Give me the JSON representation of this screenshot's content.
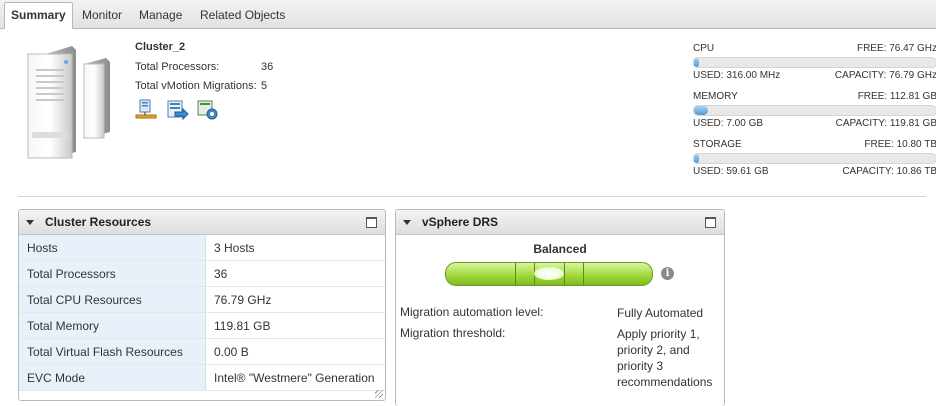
{
  "tabs": [
    {
      "label": "Summary",
      "active": true
    },
    {
      "label": "Monitor",
      "active": false
    },
    {
      "label": "Manage",
      "active": false
    },
    {
      "label": "Related Objects",
      "active": false
    }
  ],
  "summary": {
    "name": "Cluster_2",
    "stats": [
      {
        "label": "Total Processors:",
        "value": "36"
      },
      {
        "label": "Total vMotion Migrations:",
        "value": "5"
      }
    ],
    "action_icons": [
      "add-host-icon",
      "migrate-vm-icon",
      "edit-settings-icon"
    ]
  },
  "resources": {
    "cpu": {
      "name": "CPU",
      "free": "FREE: 76.47 GHz",
      "used": "USED: 316.00 MHz",
      "capacity": "CAPACITY: 76.79 GHz",
      "fraction": 0.004
    },
    "memory": {
      "name": "MEMORY",
      "free": "FREE: 112.81 GB",
      "used": "USED: 7.00 GB",
      "capacity": "CAPACITY: 119.81 GB",
      "fraction": 0.058
    },
    "storage": {
      "name": "STORAGE",
      "free": "FREE: 10.80 TB",
      "used": "USED: 59.61 GB",
      "capacity": "CAPACITY: 10.86 TB",
      "fraction": 0.005
    }
  },
  "cluster_resources": {
    "title": "Cluster Resources",
    "rows": [
      {
        "key": "Hosts",
        "value": "3 Hosts"
      },
      {
        "key": "Total Processors",
        "value": "36"
      },
      {
        "key": "Total CPU Resources",
        "value": "76.79 GHz"
      },
      {
        "key": "Total Memory",
        "value": "119.81 GB"
      },
      {
        "key": "Total Virtual Flash Resources",
        "value": "0.00 B"
      },
      {
        "key": "EVC Mode",
        "value": "Intel® \"Westmere\" Generation"
      }
    ]
  },
  "drs": {
    "title": "vSphere DRS",
    "status": "Balanced",
    "automation_label": "Migration automation level:",
    "automation_value": "Fully Automated",
    "threshold_label": "Migration threshold:",
    "threshold_value": "Apply priority 1, priority 2, and priority 3 recommendations"
  },
  "colors": {
    "accent": "#4f9ad8",
    "level_green": "#a3d93e"
  }
}
